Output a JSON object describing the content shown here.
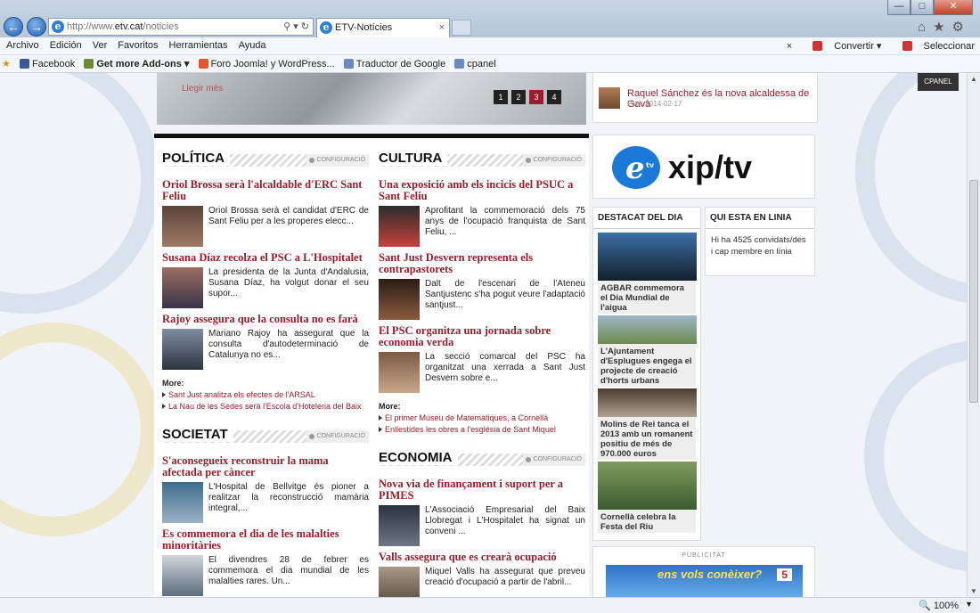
{
  "browser": {
    "address": {
      "scheme": "http://www.",
      "host": "etv.cat",
      "path": "/noticies",
      "tools": "⚲ ▾ ↻"
    },
    "tab_title": "ETV-Notícies",
    "tab_close": "×",
    "nav_back": "←",
    "nav_forward": "→",
    "window_buttons": {
      "min": "—",
      "max": "□",
      "close": "✕"
    },
    "right_tools": "⌂★⚙",
    "menu": [
      "Archivo",
      "Edición",
      "Ver",
      "Favoritos",
      "Herramientas",
      "Ayuda"
    ],
    "menu_close": "×",
    "convertir": "Convertir",
    "seleccionar": "Seleccionar",
    "favorites": [
      {
        "label": "Facebook",
        "color": "#3b5998"
      },
      {
        "label": "Get more Add-ons ▾",
        "color": "#6c8a3a"
      },
      {
        "label": "Foro Joomla! y WordPress...",
        "color": "#e8542c"
      },
      {
        "label": "Traductor de Google",
        "color": "#6b8bbf"
      },
      {
        "label": "cpanel",
        "color": "#6b8bbf"
      }
    ],
    "zoom": "100%",
    "zoom_dropdown": "▼"
  },
  "site": {
    "cpanel": "CPANEL",
    "slider": {
      "more": "Llegir més",
      "pages": [
        "1",
        "2",
        "3",
        "4"
      ],
      "active_page": "3"
    },
    "top_news": {
      "title": "Raquel Sánchez és la nova alcaldessa de Gavà",
      "date": "Post: 2014-02-17"
    },
    "config_label": "CONFIGURACIÓ",
    "more_label": "More:",
    "politica": {
      "title": "POLÍTICA",
      "articles": [
        {
          "h": "Oriol Brossa serà l'alcaldable d'ERC Sant Feliu",
          "p": "Oriol Brossa serà el candidat d'ERC de Sant Feliu per a les properes elecc..."
        },
        {
          "h": "Susana Díaz recolza el PSC a L'Hospitalet",
          "p": "La presidenta de la Junta d'Andalusia, Susana Díaz, ha volgut donar el seu supor..."
        },
        {
          "h": "Rajoy assegura que la consulta no es farà",
          "p": "Mariano Rajoy ha assegurat que la consulta d'autodeterminació de Catalunya no es..."
        }
      ],
      "more": [
        "Sant Just analitza els efectes de l'ARSAL",
        "La Nau de les Sedes serà l'Escola d'Hoteleria del Baix"
      ]
    },
    "societat": {
      "title": "SOCIETAT",
      "articles": [
        {
          "h": "S'aconsegueix reconstruir la mama afectada per càncer",
          "p": "L'Hospital de Bellvitge és pioner a realitzar la reconstrucció mamària integral,..."
        },
        {
          "h": "Es commemora el dia de les malalties minoritàries",
          "p": "El divendres 28 de febrer es commemora el dia mundial de les malalties rares. Un..."
        }
      ]
    },
    "cultura": {
      "title": "CULTURA",
      "articles": [
        {
          "h": "Una exposició amb els incicis del PSUC a Sant Feliu",
          "p": "Aprofitant la commemoració dels 75 anys de l'ocupació franquista de Sant Feliu, ..."
        },
        {
          "h": "Sant Just Desvern representa els contrapastorets",
          "p": "Dalt de l'escenari de l'Ateneu Santjustenc s'ha pogut veure l'adaptació santjust..."
        },
        {
          "h": "El PSC organitza una jornada sobre economia verda",
          "p": "La secció comarcal del PSC ha organitzat una xerrada a Sant Just Desvern sobre e..."
        }
      ],
      "more": [
        "El primer Museu de Matemàtiques, a Cornellà",
        "Enllestides les obres a l'església de Sant Miquel"
      ]
    },
    "economia": {
      "title": "ECONOMIA",
      "articles": [
        {
          "h": "Nova via de finançament i suport per a PIMES",
          "p": "L'Associació Empresarial del Baix Llobregat i L'Hospitalet ha signat un conveni ..."
        },
        {
          "h": "Valls assegura que es crearà ocupació",
          "p": "Miquel Valls ha assegurat que preveu creació d'ocupació a partir de l'abril..."
        }
      ]
    },
    "logo": {
      "text": "xip/tv",
      "mark": "e",
      "sub": "tv"
    },
    "destacat": {
      "title": "DESTACAT DEL DIA",
      "items": [
        "AGBAR commemora el Dia Mundial de l'aigua",
        "L'Ajuntament d'Esplugues engega el projecte de creació d'horts urbans",
        "Molins de Rei tanca el 2013 amb un romanent positiu de més de 970.000 euros",
        "Cornellà celebra la Festa del Riu"
      ]
    },
    "online": {
      "title": "QUI ESTA EN LINIA",
      "text": "Hi ha 4525 convidats/des i cap membre en línia"
    },
    "publicitat": "PUBLICITAT",
    "ad": {
      "text": "ens vols conèixer?",
      "date": "5"
    }
  }
}
